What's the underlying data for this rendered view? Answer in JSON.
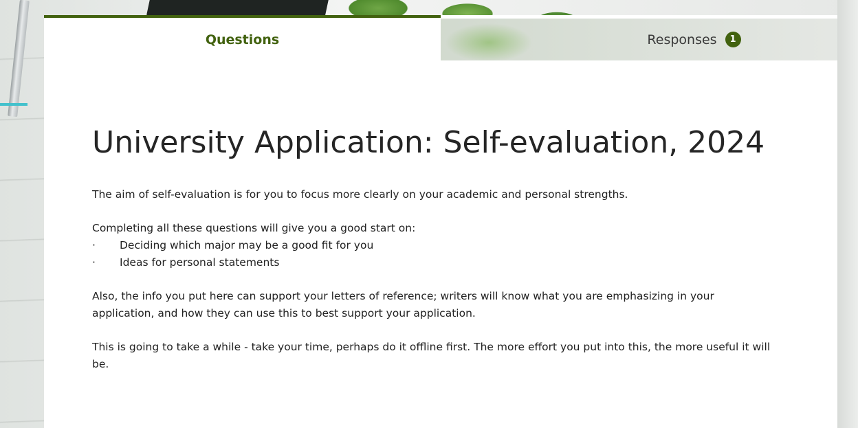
{
  "tabs": {
    "questions_label": "Questions",
    "responses_label": "Responses",
    "responses_count": "1"
  },
  "form": {
    "title": "University Application: Self-evaluation, 2024",
    "intro": "The aim of self-evaluation is for you to focus more clearly on your academic and personal strengths.",
    "list_intro": "Completing all these questions will give you a good start on:",
    "list_items": [
      "Deciding which major may be a good fit for you",
      "Ideas for personal statements"
    ],
    "bullet": "·",
    "references": "Also, the info you put here can support your letters of reference; writers will know what you are emphasizing in your application, and how they can use this to best support your application.",
    "time_note": "This is going to take a while - take your time, perhaps do it offline first.  The more effort you put into this, the more useful it will be."
  },
  "colors": {
    "accent": "#42620f",
    "badge_text": "#ffffff",
    "title_text": "#252525"
  }
}
